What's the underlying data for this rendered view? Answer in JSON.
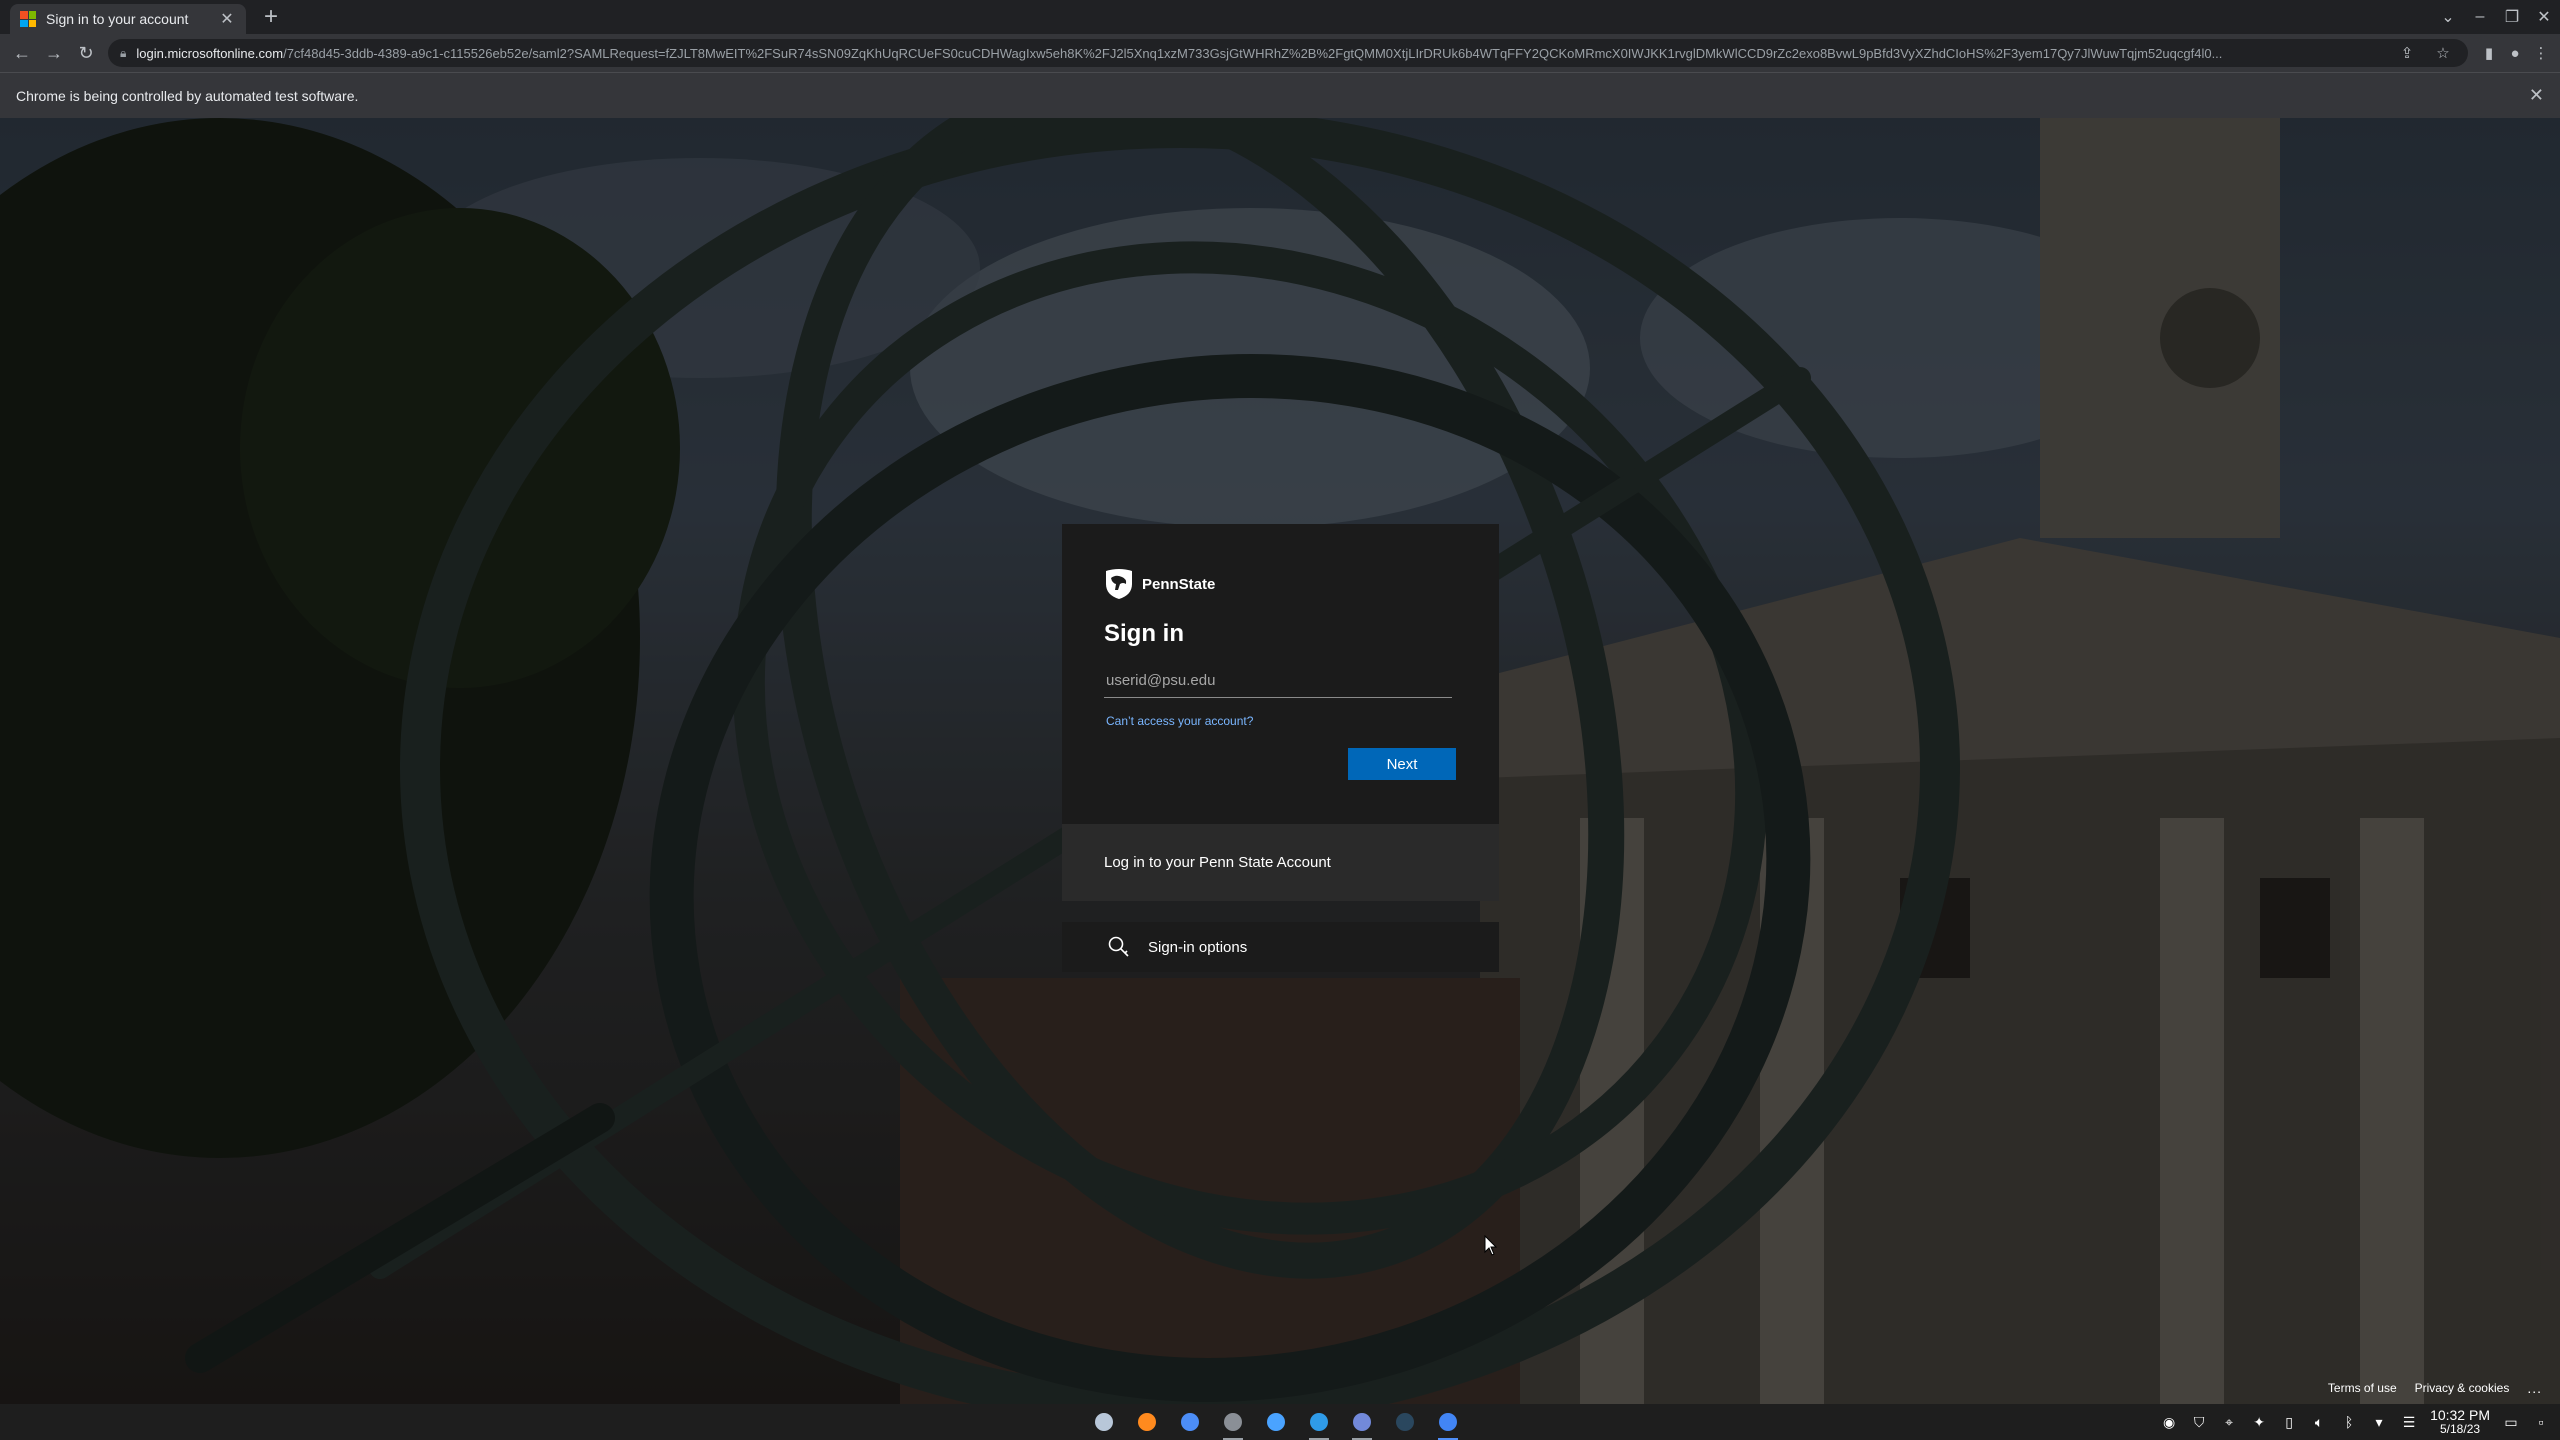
{
  "browser": {
    "tab": {
      "title": "Sign in to your account"
    },
    "url": {
      "domain": "login.microsoftonline.com",
      "path": "/7cf48d45-3ddb-4389-a9c1-c115526eb52e/saml2?SAMLRequest=fZJLT8MwEIT%2FSuR74sSN09ZqKhUqRCUeFS0cuCDHWagIxw5eh8K%2FJ2l5Xnq1xzM733GsjGtWHRhZ%2B%2FgtQMM0XtjLIrDRUk6b4WTqFFY2QCKoMRmcX0IWJKK1rvglDMkWlCCD9rZc2exo8BvwL9pBfd3VyXZhdCIoHS%2F3yem17Qy7JlWuwTqjm52uqcgf4l0..."
    },
    "infobar": "Chrome is being controlled by automated test software."
  },
  "signin": {
    "brand": "PennState",
    "heading": "Sign in",
    "email_placeholder": "userid@psu.edu",
    "cant_access": "Can’t access your account?",
    "next_label": "Next",
    "footer_text": "Log in to your Penn State Account",
    "options_label": "Sign-in options"
  },
  "page_footer": {
    "terms": "Terms of use",
    "privacy": "Privacy & cookies",
    "more": "..."
  },
  "taskbar": {
    "apps": [
      {
        "name": "launcher",
        "color": "#b8c7d9"
      },
      {
        "name": "firefox",
        "color": "#ff8a1e"
      },
      {
        "name": "chromium",
        "color": "#4c8df6"
      },
      {
        "name": "gear-app",
        "color": "#8a8f96"
      },
      {
        "name": "messenger",
        "color": "#4aa3ff"
      },
      {
        "name": "vscode",
        "color": "#2f9be8"
      },
      {
        "name": "discord",
        "color": "#7289da"
      },
      {
        "name": "steam",
        "color": "#2a475e"
      },
      {
        "name": "chrome",
        "color": "#4285f4"
      }
    ],
    "time": "10:32 PM",
    "date": "5/18/23"
  },
  "colors": {
    "accent": "#0067b8",
    "link": "#7ab6ff",
    "card_bg": "#1b1b1b"
  }
}
